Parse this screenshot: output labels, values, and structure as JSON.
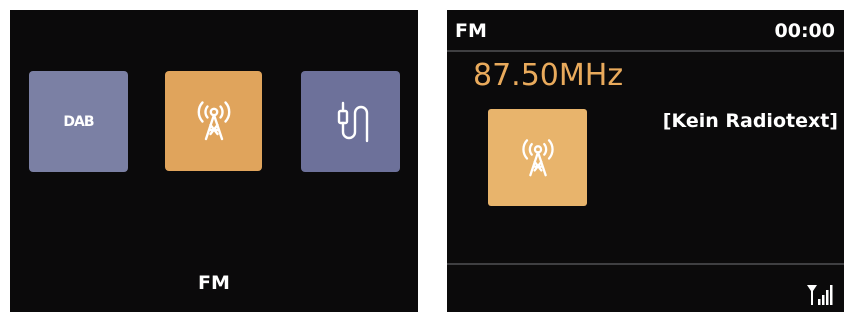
{
  "colors": {
    "screen_bg": "#0b0a0b",
    "dab_tile": "#7b80a4",
    "fm_tile": "#e0a45c",
    "aux_tile": "#6d719a",
    "station_tile": "#e8b46c",
    "frequency_text": "#e9aa5c",
    "icon_stroke": "#ffffff",
    "divider": "#3f3f42"
  },
  "source_menu": {
    "tiles": [
      {
        "id": "dab",
        "label": "DAB",
        "icon": "dab-logo"
      },
      {
        "id": "fm",
        "icon": "radio-tower-icon",
        "selected": true
      },
      {
        "id": "aux",
        "icon": "aux-cable-icon"
      }
    ],
    "selected_label": "FM"
  },
  "playback": {
    "mode": "FM",
    "clock": "00:00",
    "frequency": "87.50MHz",
    "radiotext": "[Kein Radiotext]",
    "station_icon": "radio-tower-icon",
    "signal_icon": "signal-strength-icon"
  }
}
